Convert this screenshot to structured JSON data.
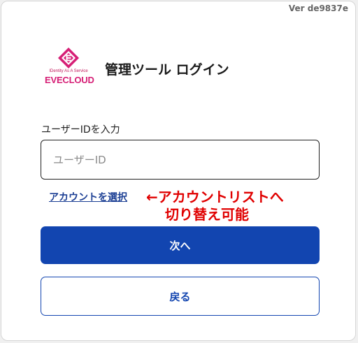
{
  "version": "Ver de9837e",
  "brand": {
    "logo_icon": "evecloud-logo-icon",
    "tagline": "IDentity As A Service",
    "wordmark": "EVECLOUD",
    "color": "#d61f76"
  },
  "title": "管理ツール ログイン",
  "form": {
    "user_id_label": "ユーザーIDを入力",
    "user_id_placeholder": "ユーザーID",
    "user_id_value": ""
  },
  "account_link": "アカウントを選択",
  "annotation": {
    "line1": "←アカウントリストへ",
    "line2": "切り替え可能",
    "color": "#e00000"
  },
  "buttons": {
    "next": "次へ",
    "back": "戻る"
  },
  "colors": {
    "primary": "#1245b0",
    "link": "#1c3f94"
  }
}
